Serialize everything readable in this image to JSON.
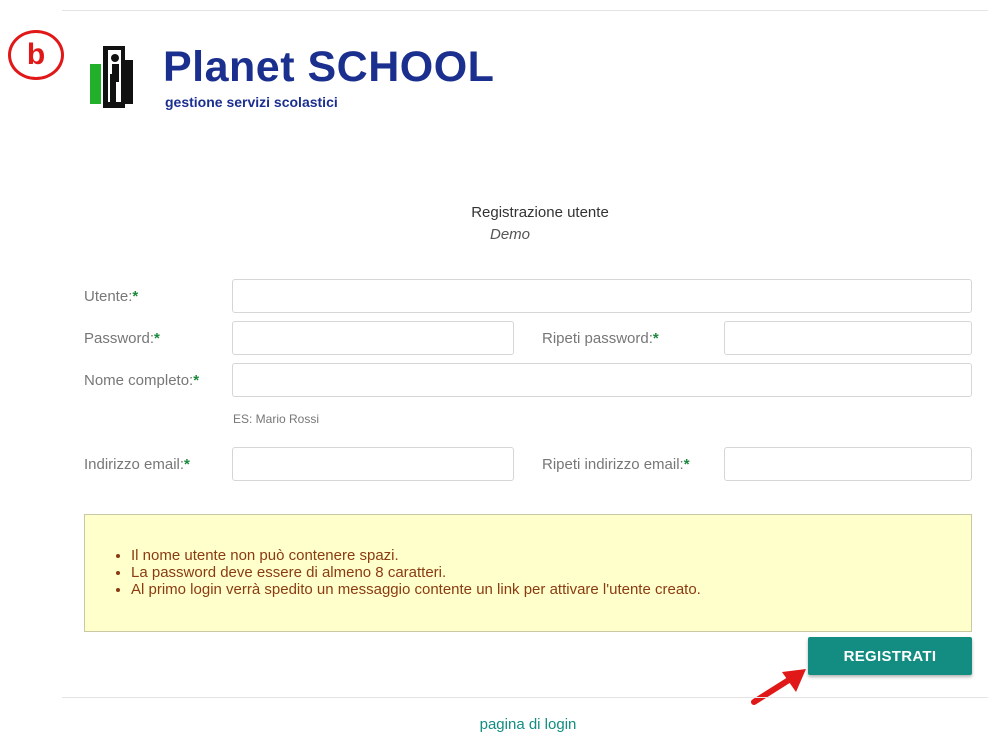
{
  "annotation": {
    "marker_letter": "b"
  },
  "logo": {
    "title": "Planet SCHOOL",
    "subtitle": "gestione servizi scolastici"
  },
  "form": {
    "title": "Registrazione utente",
    "subtitle": "Demo",
    "fields": {
      "utente": {
        "label": "Utente:",
        "value": "",
        "placeholder": ""
      },
      "password": {
        "label": "Password:",
        "value": "",
        "placeholder": ""
      },
      "ripeti_password": {
        "label": "Ripeti password:",
        "value": "",
        "placeholder": ""
      },
      "nome_completo": {
        "label": "Nome completo:",
        "value": "",
        "placeholder": "",
        "hint": "ES: Mario Rossi"
      },
      "email": {
        "label": "Indirizzo email:",
        "value": "",
        "placeholder": ""
      },
      "ripeti_email": {
        "label": "Ripeti indirizzo email:",
        "value": "",
        "placeholder": ""
      }
    },
    "required_mark": "*"
  },
  "info": {
    "items": [
      "Il nome utente non può contenere spazi.",
      "La password deve essere di almeno 8 caratteri.",
      "Al primo login verrà spedito un messaggio contente un link per attivare l'utente creato."
    ]
  },
  "actions": {
    "register_label": "REGISTRATI",
    "login_link": "pagina di login"
  },
  "icons": {
    "annotation_arrow": "red-arrow-icon",
    "logo_mark": "building-person-icon"
  },
  "colors": {
    "brand_blue": "#1b2f8f",
    "accent_teal": "#138d81",
    "required_green": "#1a8a3a",
    "info_bg": "#ffffcc",
    "info_text": "#8a3b12",
    "annotation_red": "#e01818"
  }
}
